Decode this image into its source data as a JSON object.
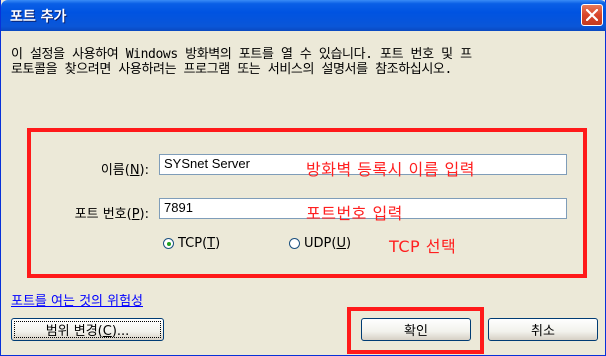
{
  "window": {
    "title": "포트 추가"
  },
  "description": {
    "line1": "이 설정을 사용하여 Windows 방화벽의 포트를 열 수 있습니다. 포트 번호 및 프",
    "line2": "로토콜을 찾으려면 사용하려는 프로그램 또는 서비스의 설명서를 참조하십시오."
  },
  "form": {
    "name_label_prefix": "이름(",
    "name_label_key": "N",
    "name_label_suffix": "):",
    "name_value": "SYSnet Server",
    "port_label_prefix": "포트 번호(",
    "port_label_key": "P",
    "port_label_suffix": "):",
    "port_value": "7891",
    "protocols": {
      "tcp": {
        "prefix": "TCP(",
        "key": "T",
        "suffix": ")",
        "selected": true
      },
      "udp": {
        "prefix": "UDP(",
        "key": "U",
        "suffix": ")",
        "selected": false
      }
    }
  },
  "annotations": {
    "name_hint": "방화벽 등록시 이름 입력",
    "port_hint": "포트번호 입력",
    "protocol_hint": "TCP 선택",
    "color": "#ff1a1a"
  },
  "footer": {
    "risk_link": "포트를 여는 것의 위험성",
    "scope_prefix": "범위 변경(",
    "scope_key": "C",
    "scope_suffix": ")...",
    "ok_label": "확인",
    "cancel_label": "취소"
  },
  "colors": {
    "title_bar": "#0053e1",
    "dialog_bg": "#ece9d8",
    "link": "#0000ff",
    "close_button": "#d9452a"
  },
  "icons": {
    "close": "close-x-icon",
    "radio_selected": "radio-selected-icon",
    "radio_unselected": "radio-unselected-icon"
  }
}
